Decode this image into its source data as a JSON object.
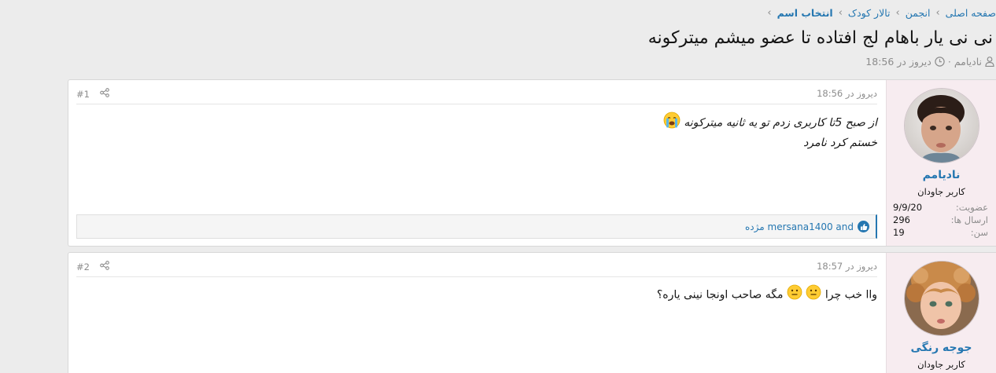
{
  "breadcrumb": {
    "items": [
      "صفحه اصلی",
      "انجمن",
      "تالار کودک",
      "انتخاب اسم"
    ]
  },
  "thread": {
    "title": "نی نی یار باهام لج افتاده تا عضو میشم میترکونه",
    "author": "نادیامم",
    "date": "دیروز در 18:56",
    "separator": "·"
  },
  "posts": [
    {
      "username": "نادیامم",
      "user_title": "کاربر جاودان",
      "stats": [
        {
          "label": "عضویت:",
          "value": "9/9/20"
        },
        {
          "label": "ارسال ها:",
          "value": "296"
        },
        {
          "label": "سن:",
          "value": "19"
        }
      ],
      "date": "دیروز در 18:56",
      "number": "#1",
      "body_line1": "از صبح 5تا کاربری زدم تو یه ثانیه میترکونه",
      "body_line2": "خستم کرد نامرد",
      "reactions": "mersana1400 and مژده"
    },
    {
      "username": "جوجه رنگی",
      "user_title": "کاربر جاودان",
      "date": "دیروز در 18:57",
      "number": "#2",
      "body_part1": "واا خب چرا",
      "body_part2": " مگه صاحب اونجا نینی یاره؟"
    }
  ],
  "icons": {
    "user": "user-icon",
    "clock": "clock-icon",
    "share": "share-icon",
    "like": "like-icon",
    "crying": "crying-emoji-icon",
    "neutral": "neutral-emoji-icon"
  },
  "colors": {
    "accent": "#2577b1",
    "user_cell_bg": "#f7ecf0",
    "page_bg": "#ececec"
  }
}
